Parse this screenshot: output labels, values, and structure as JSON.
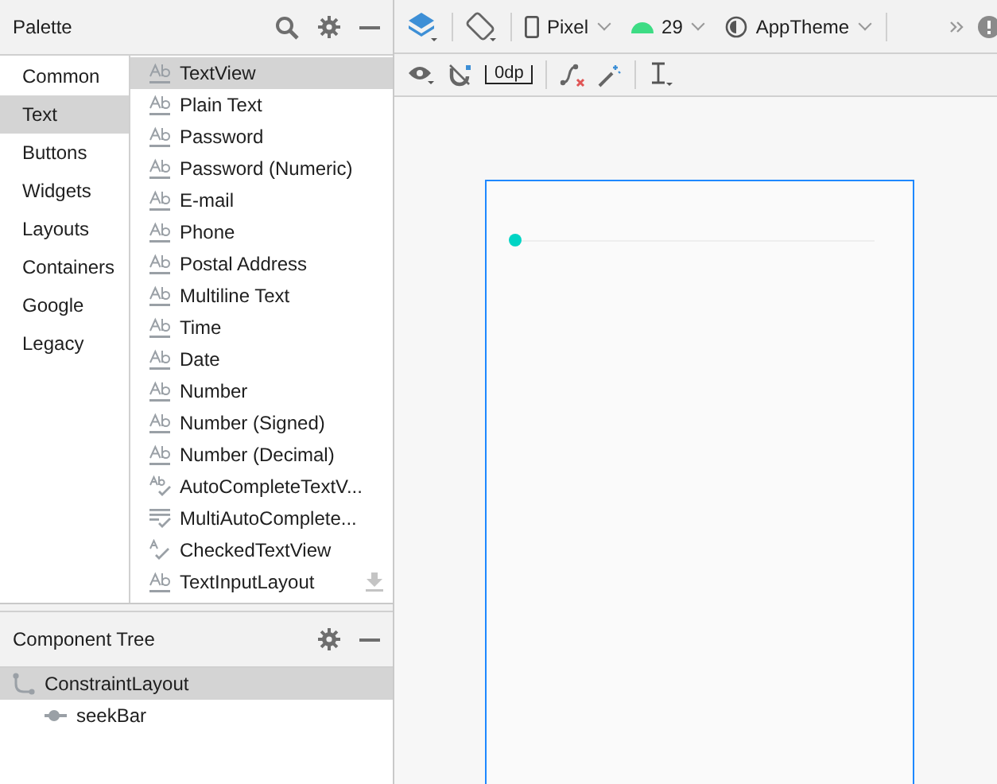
{
  "palette": {
    "title": "Palette",
    "categories": [
      {
        "label": "Common",
        "selected": false
      },
      {
        "label": "Text",
        "selected": true
      },
      {
        "label": "Buttons",
        "selected": false
      },
      {
        "label": "Widgets",
        "selected": false
      },
      {
        "label": "Layouts",
        "selected": false
      },
      {
        "label": "Containers",
        "selected": false
      },
      {
        "label": "Google",
        "selected": false
      },
      {
        "label": "Legacy",
        "selected": false
      }
    ],
    "items": [
      {
        "label": "TextView",
        "kind": "ab",
        "selected": true,
        "downloadable": false
      },
      {
        "label": "Plain Text",
        "kind": "ab",
        "selected": false,
        "downloadable": false
      },
      {
        "label": "Password",
        "kind": "ab",
        "selected": false,
        "downloadable": false
      },
      {
        "label": "Password (Numeric)",
        "kind": "ab",
        "selected": false,
        "downloadable": false
      },
      {
        "label": "E-mail",
        "kind": "ab",
        "selected": false,
        "downloadable": false
      },
      {
        "label": "Phone",
        "kind": "ab",
        "selected": false,
        "downloadable": false
      },
      {
        "label": "Postal Address",
        "kind": "ab",
        "selected": false,
        "downloadable": false
      },
      {
        "label": "Multiline Text",
        "kind": "ab",
        "selected": false,
        "downloadable": false
      },
      {
        "label": "Time",
        "kind": "ab",
        "selected": false,
        "downloadable": false
      },
      {
        "label": "Date",
        "kind": "ab",
        "selected": false,
        "downloadable": false
      },
      {
        "label": "Number",
        "kind": "ab",
        "selected": false,
        "downloadable": false
      },
      {
        "label": "Number (Signed)",
        "kind": "ab",
        "selected": false,
        "downloadable": false
      },
      {
        "label": "Number (Decimal)",
        "kind": "ab",
        "selected": false,
        "downloadable": false
      },
      {
        "label": "AutoCompleteTextV...",
        "kind": "abcheck",
        "selected": false,
        "downloadable": false
      },
      {
        "label": "MultiAutoComplete...",
        "kind": "linescheck",
        "selected": false,
        "downloadable": false
      },
      {
        "label": "CheckedTextView",
        "kind": "acheck",
        "selected": false,
        "downloadable": false
      },
      {
        "label": "TextInputLayout",
        "kind": "ab",
        "selected": false,
        "downloadable": true
      }
    ]
  },
  "component_tree": {
    "title": "Component Tree",
    "nodes": [
      {
        "label": "ConstraintLayout",
        "kind": "layout",
        "selected": true,
        "children": [
          {
            "label": "seekBar",
            "kind": "seekbar",
            "selected": false
          }
        ]
      }
    ]
  },
  "toolbar": {
    "device": "Pixel",
    "api": "29",
    "theme": "AppTheme",
    "margin": "0dp"
  },
  "canvas": {
    "seekbar": {
      "level": 0
    }
  }
}
